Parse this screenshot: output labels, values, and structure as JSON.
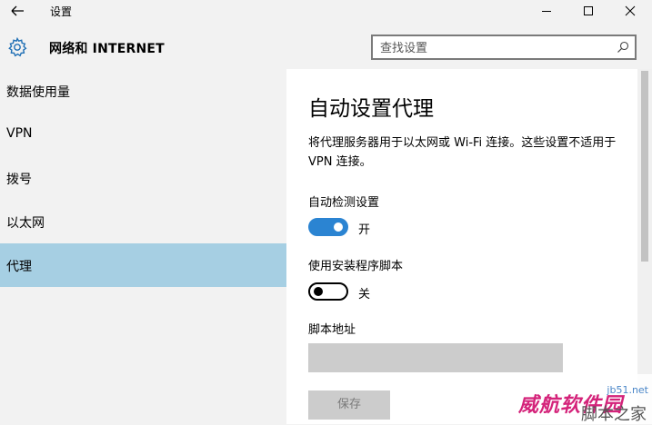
{
  "titlebar": {
    "title": "设置",
    "back_icon": "arrow-left-icon",
    "minimize_icon": "minimize-icon",
    "maximize_icon": "maximize-icon",
    "close_icon": "close-icon"
  },
  "header": {
    "icon": "gear-icon",
    "title": "网络和 INTERNET",
    "search": {
      "placeholder": "查找设置",
      "value": "",
      "icon": "search-icon"
    }
  },
  "sidebar": {
    "items": [
      {
        "label": "数据使用量",
        "selected": false
      },
      {
        "label": "VPN",
        "selected": false
      },
      {
        "label": "拨号",
        "selected": false
      },
      {
        "label": "以太网",
        "selected": false
      },
      {
        "label": "代理",
        "selected": true
      }
    ]
  },
  "content": {
    "title": "自动设置代理",
    "description": "将代理服务器用于以太网或 Wi-Fi 连接。这些设置不适用于 VPN 连接。",
    "auto_detect": {
      "label": "自动检测设置",
      "state": "开",
      "on": true
    },
    "setup_script": {
      "label": "使用安装程序脚本",
      "state": "关",
      "on": false
    },
    "script_address": {
      "label": "脚本地址",
      "value": ""
    },
    "save_button": "保存"
  },
  "watermark": {
    "main": "威航软件园",
    "url": "jb51.net",
    "sub": "脚本之家"
  },
  "colors": {
    "accent": "#2b84d2",
    "selected_nav": "#a6cfe3",
    "sidebar_bg": "#f2f2f2",
    "content_bg": "#ffffff",
    "disabled_fill": "#cccccc"
  }
}
